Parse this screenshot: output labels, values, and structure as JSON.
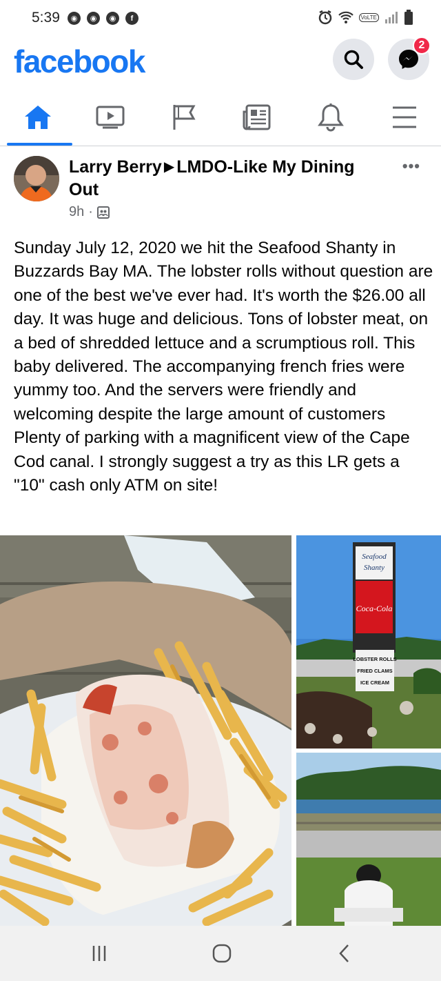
{
  "status_bar": {
    "time": "5:39",
    "notification_icons": [
      "app-icon",
      "app-icon",
      "app-icon",
      "facebook-icon"
    ],
    "right_icons": [
      "alarm-icon",
      "wifi-icon",
      "volte-icon",
      "signal-icon",
      "battery-icon"
    ],
    "volte_label": "VoLTE"
  },
  "header": {
    "logo": "facebook",
    "messenger_badge": "2"
  },
  "nav": {
    "tabs": [
      "home",
      "watch",
      "pages",
      "news",
      "notifications",
      "menu"
    ],
    "active": "home"
  },
  "post": {
    "author": "Larry Berry",
    "group": "LMDO-Like My Dining Out",
    "time": "9h",
    "separator": "·",
    "more": "•••",
    "text": "Sunday July 12, 2020 we hit the Seafood Shanty in Buzzards Bay MA. The lobster rolls without question are one of the best we've ever had.  It's worth the $26.00 all day. It was huge and delicious. Tons of lobster meat, on a bed of shredded lettuce and a scrumptious roll. This baby delivered. The accompanying french fries were yummy too. And the servers were friendly and welcoming despite the large amount of customers Plenty of parking with a magnificent view of the Cape Cod canal.  I strongly suggest a try as this LR gets a \"10\"  cash only ATM on site!",
    "photo_sign_text": {
      "name_line1": "Seafood",
      "name_line2": "Shanty",
      "brand": "Coca-Cola",
      "menu1": "LOBSTER ROLLS",
      "menu2": "FRIED CLAMS",
      "menu3": "ICE CREAM"
    }
  },
  "colors": {
    "brand": "#1877f2",
    "badge": "#f02849",
    "secondary_text": "#65676b",
    "icon_bg": "#e4e6eb"
  }
}
